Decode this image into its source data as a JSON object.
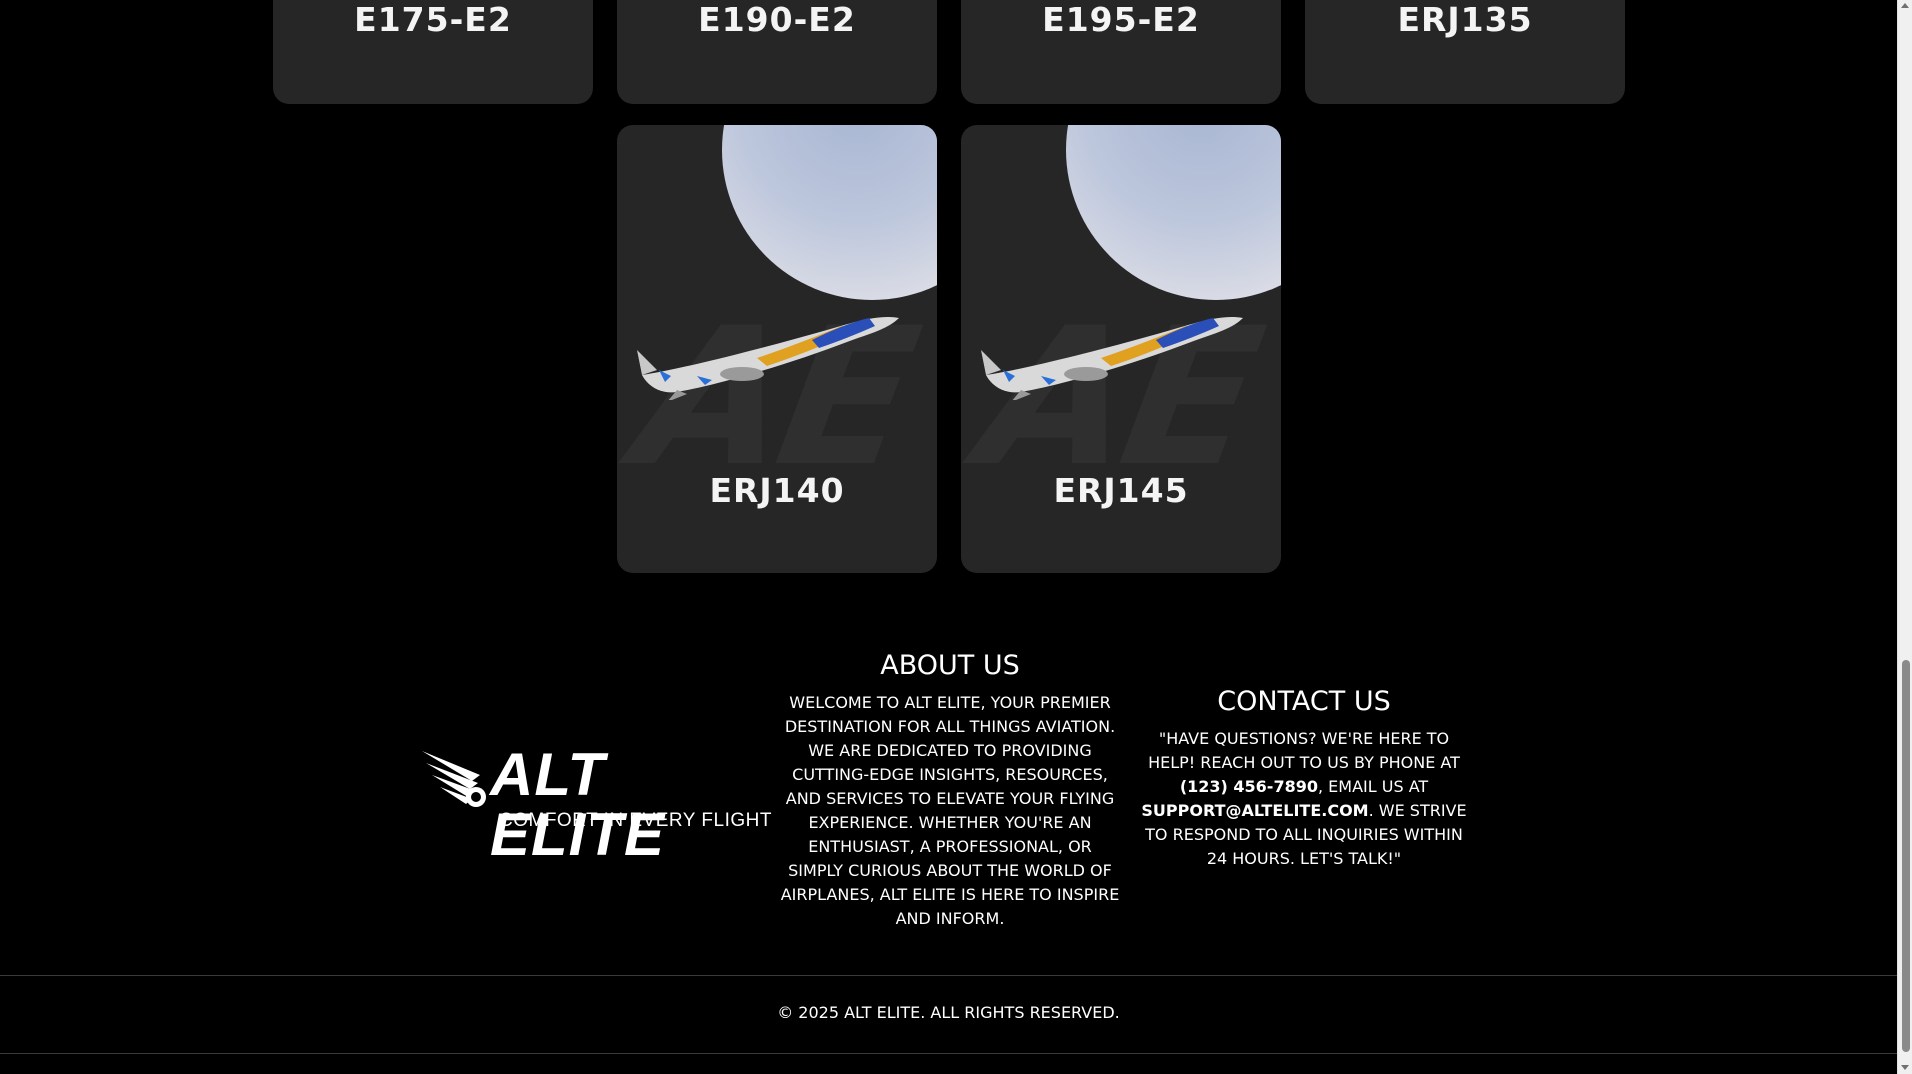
{
  "aircraft_cards": [
    {
      "name": "E175-E2"
    },
    {
      "name": "E190-E2"
    },
    {
      "name": "E195-E2"
    },
    {
      "name": "ERJ135"
    },
    {
      "name": "ERJ140",
      "watermark": "AE"
    },
    {
      "name": "ERJ145",
      "watermark": "AE"
    }
  ],
  "logo": {
    "name": "ALT ELITE",
    "tagline": "COMFORT IN EVERY FLIGHT"
  },
  "about": {
    "title": "ABOUT US",
    "body": "WELCOME TO ALT ELITE, YOUR PREMIER DESTINATION FOR ALL THINGS AVIATION. WE ARE DEDICATED TO PROVIDING CUTTING-EDGE INSIGHTS, RESOURCES, AND SERVICES TO ELEVATE YOUR FLYING EXPERIENCE. WHETHER YOU'RE AN ENTHUSIAST, A PROFESSIONAL, OR SIMPLY CURIOUS ABOUT THE WORLD OF AIRPLANES, ALT ELITE IS HERE TO INSPIRE AND INFORM."
  },
  "contact": {
    "title": "CONTACT US",
    "text_1": "\"HAVE QUESTIONS? WE'RE HERE TO HELP! REACH OUT TO US BY PHONE AT ",
    "phone": "(123) 456-7890",
    "text_2": ", EMAIL US AT ",
    "email": "SUPPORT@ALTELITE.COM",
    "text_3": ". WE STRIVE TO RESPOND TO ALL INQUIRIES WITHIN 24 HOURS. LET'S TALK!\""
  },
  "footer": {
    "copyright": "© 2025 ALT ELITE. ALL RIGHTS RESERVED."
  },
  "colors": {
    "background": "#000000",
    "card": "#262626",
    "text": "#ffffff"
  }
}
